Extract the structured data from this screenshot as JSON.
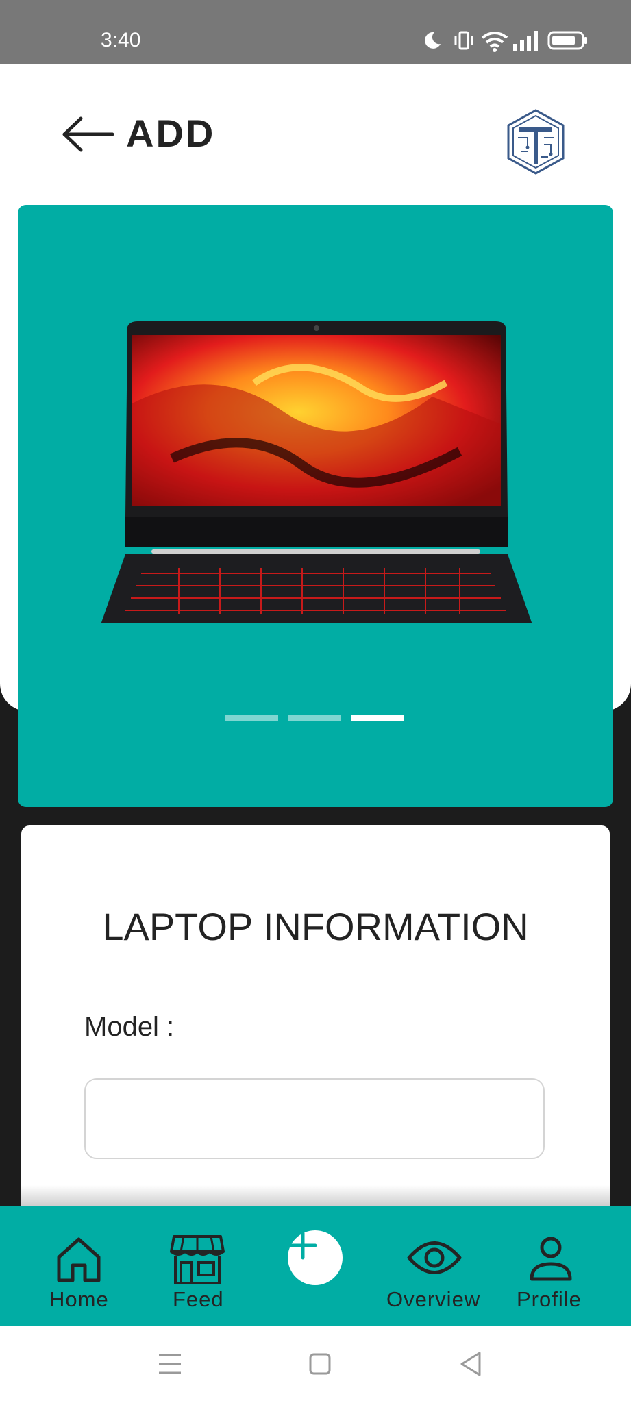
{
  "status_bar": {
    "time": "3:40",
    "icons": [
      "moon-icon",
      "vibrate-icon",
      "wifi-icon",
      "signal-icon",
      "battery-icon"
    ]
  },
  "header": {
    "title": "ADD",
    "back_icon": "arrow-left-icon",
    "logo_icon": "circuit-t-logo-icon"
  },
  "carousel": {
    "image": "acer-laptop",
    "slide_count": 3,
    "active_index": 2
  },
  "info_card": {
    "title": "LAPTOP INFORMATION",
    "model_label": "Model :",
    "model_value": "",
    "model_placeholder": ""
  },
  "bottom_nav": {
    "items": [
      {
        "label": "Home",
        "icon": "home-icon"
      },
      {
        "label": "Feed",
        "icon": "store-icon"
      },
      {
        "label": "",
        "icon": "plus-icon"
      },
      {
        "label": "Overview",
        "icon": "eye-icon"
      },
      {
        "label": "Profile",
        "icon": "user-icon"
      }
    ]
  },
  "system_nav": {
    "icons": [
      "menu-icon",
      "home-square-icon",
      "back-triangle-icon"
    ]
  },
  "colors": {
    "accent": "#01ada4",
    "status_bar": "#787878",
    "backdrop": "#1c1c1c",
    "text": "#232323"
  }
}
